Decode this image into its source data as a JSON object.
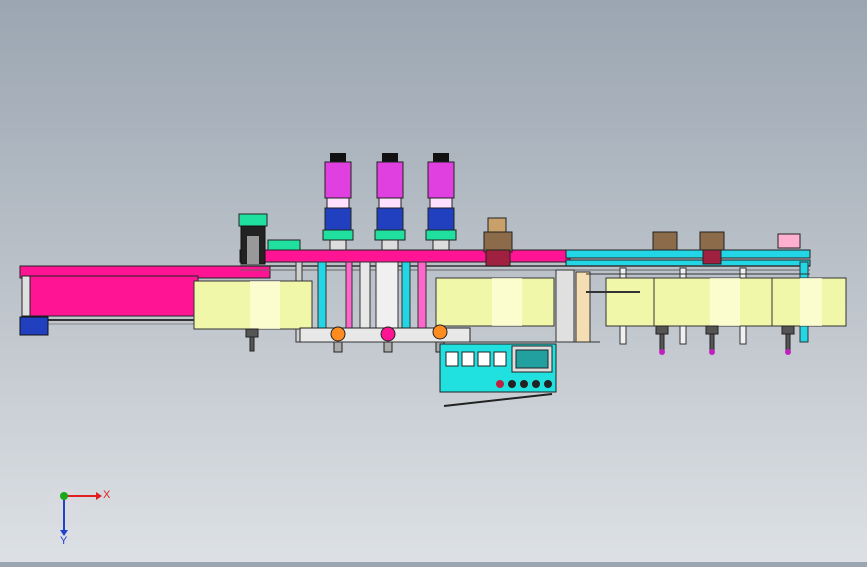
{
  "viewport": {
    "background_top": "#9ba6b2",
    "background_bottom": "#dde1e5"
  },
  "triad": {
    "x_label": "X",
    "y_label": "Y",
    "x_color": "#e02020",
    "y_color": "#1aa81a",
    "z_color": "#2040d0"
  },
  "palette": {
    "conveyor_magenta": "#ff1493",
    "motor_magenta": "#e040e0",
    "roller_yellow": "#f0f7a8",
    "rail_cyan": "#22d6e6",
    "control_cyan": "#20e0e0",
    "green_block": "#20e0a0",
    "blue_block": "#2040c0"
  },
  "icons": [
    "axis-triad-icon"
  ]
}
